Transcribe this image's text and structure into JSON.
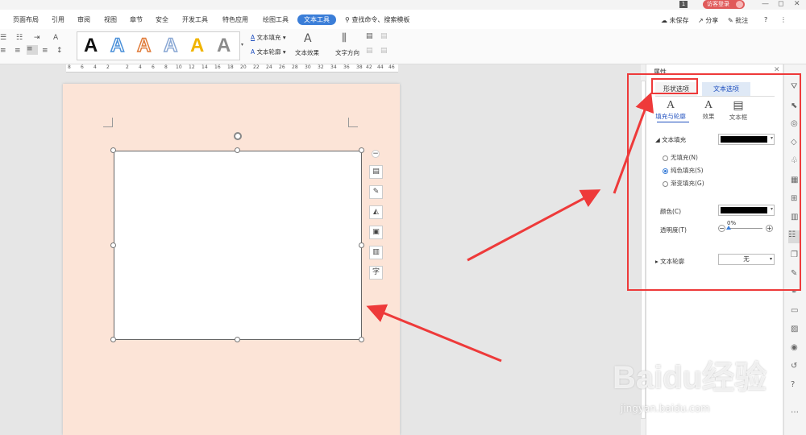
{
  "titlebar": {
    "page_count": "1",
    "guest_label": "访客登录",
    "min": "—",
    "max": "◻",
    "close": "✕"
  },
  "menubar": {
    "items": [
      "页面布局",
      "引用",
      "审阅",
      "视图",
      "章节",
      "安全",
      "开发工具",
      "特色应用",
      "绘图工具"
    ],
    "active": "文本工具",
    "search": "查找命令、搜索模板",
    "unsaved": "未保存",
    "share": "分享",
    "comment": "批注",
    "help": "?",
    "more": "⋮"
  },
  "ribbon": {
    "style_letter": "A",
    "style_colors": [
      "#111111",
      "#4a90d9",
      "#e07b39",
      "#8aa8d4",
      "#f0b400",
      "#8c8c8c"
    ],
    "fill_label": "文本填充",
    "outline_label": "文本轮廓",
    "effect_label": "文本效果",
    "direction_label": "文字方向"
  },
  "ruler": {
    "ticks": [
      "8",
      "6",
      "4",
      "2",
      "2",
      "4",
      "6",
      "8",
      "10",
      "12",
      "14",
      "16",
      "18",
      "20",
      "22",
      "24",
      "26",
      "28",
      "30",
      "32",
      "34",
      "36",
      "38",
      "42",
      "44",
      "46"
    ]
  },
  "panel": {
    "title": "属性",
    "tab_shape": "形状选项",
    "tab_text": "文本选项",
    "subtab_fill": "填充与轮廓",
    "subtab_effect": "效果",
    "subtab_textbox": "文本框",
    "section_fill": "文本填充",
    "radio_none": "无填充(N)",
    "radio_solid": "纯色填充(S)",
    "radio_gradient": "渐变填充(G)",
    "color_label": "颜色(C)",
    "transparency_label": "透明度(T)",
    "transparency_value": "0%",
    "transparency_fraction": 0,
    "section_outline": "文本轮廓",
    "outline_value": "无",
    "fill_color": "#000000"
  },
  "annotations": {
    "color": "#ee3a3a"
  },
  "watermark": {
    "text": "Baidu经验",
    "sub": "jingyan.baidu.com"
  }
}
